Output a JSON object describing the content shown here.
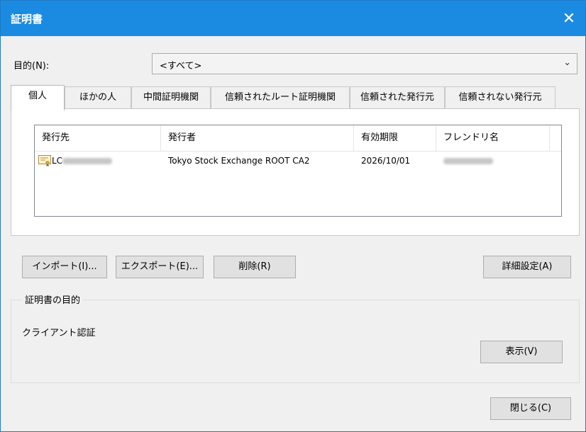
{
  "window": {
    "title": "証明書",
    "close_glyph": "✕"
  },
  "purpose": {
    "label": "目的(N):",
    "value": "<すべて>",
    "chevron": "⌄"
  },
  "tabs": [
    {
      "label": "個人",
      "active": true
    },
    {
      "label": "ほかの人"
    },
    {
      "label": "中間証明機関"
    },
    {
      "label": "信頼されたルート証明機関"
    },
    {
      "label": "信頼された発行元"
    },
    {
      "label": "信頼されない発行元"
    }
  ],
  "list": {
    "columns": [
      "発行先",
      "発行者",
      "有効期限",
      "フレンドリ名"
    ],
    "rows": [
      {
        "issued_to": "LC",
        "issued_by": "Tokyo Stock Exchange ROOT CA2",
        "expires": "2026/10/01",
        "friendly_name": "",
        "icon": "certificate-icon"
      }
    ]
  },
  "buttons": {
    "import": "インポート(I)...",
    "export": "エクスポート(E)...",
    "remove": "削除(R)",
    "advanced": "詳細設定(A)",
    "view": "表示(V)",
    "close": "閉じる(C)"
  },
  "cert_purpose": {
    "group_label": "証明書の目的",
    "value": "クライアント認証"
  },
  "colors": {
    "titlebar": "#1a8be0",
    "window_bg": "#f0f0f0"
  }
}
